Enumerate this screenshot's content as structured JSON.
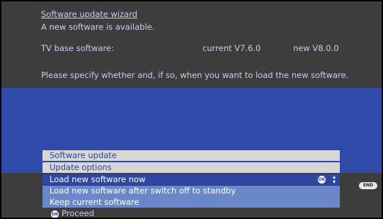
{
  "header": {
    "title": "Software update wizard",
    "message": "A new software is available."
  },
  "software": {
    "label": "TV base software:",
    "current": "current V7.6.0",
    "new": "new V8.0.0"
  },
  "instruction": "Please specify whether and, if so, when you want to load the new software.",
  "panel": {
    "title": "Software update",
    "subtitle": "Update options",
    "options": [
      "Load new software now",
      "Load new software after switch off to standby",
      "Keep current software"
    ],
    "selected_index": 0,
    "ok_badge": "OK",
    "updown_icon": "up-down-arrows"
  },
  "footer": {
    "ok_icon_label": "OK",
    "proceed_label": "Proceed",
    "end_label": "END"
  },
  "colors": {
    "background": "#3d3d3d",
    "band": "#2f4aa8",
    "selected_option": "#31469e",
    "option": "#6a88c8",
    "panel_header": "#d6d6d6",
    "text": "#c3d0f0"
  }
}
